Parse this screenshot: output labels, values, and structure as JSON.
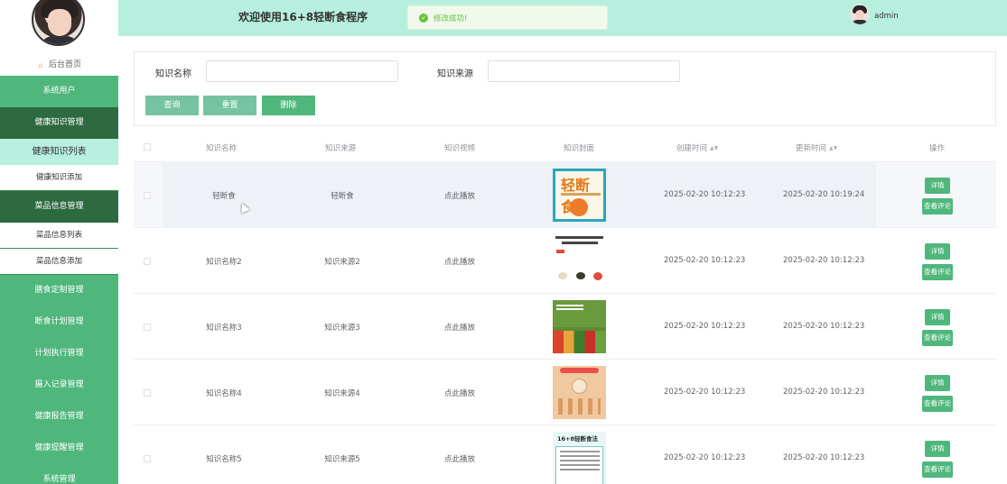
{
  "header": {
    "welcome": "欢迎使用16+8轻断食程序",
    "toast": "修改成功!",
    "username": "admin"
  },
  "sidebar": {
    "home": "后台首页",
    "items": [
      {
        "label": "系统用户",
        "style": "normal"
      },
      {
        "label": "健康知识管理",
        "style": "dark"
      },
      {
        "label": "健康知识列表",
        "style": "active-sub"
      },
      {
        "label": "健康知识添加",
        "style": "sub"
      },
      {
        "label": "菜品信息管理",
        "style": "dark"
      },
      {
        "label": "菜品信息列表",
        "style": "sub"
      },
      {
        "label": "菜品信息添加",
        "style": "sub"
      },
      {
        "label": "膳食定制管理",
        "style": "normal"
      },
      {
        "label": "断食计划管理",
        "style": "normal"
      },
      {
        "label": "计划执行管理",
        "style": "normal"
      },
      {
        "label": "摄入记录管理",
        "style": "normal"
      },
      {
        "label": "健康报告管理",
        "style": "normal"
      },
      {
        "label": "健康提醒管理",
        "style": "normal"
      },
      {
        "label": "系统管理",
        "style": "normal"
      }
    ]
  },
  "search": {
    "name_label": "知识名称",
    "name_value": "",
    "source_label": "知识来源",
    "source_value": "",
    "query": "查询",
    "reset": "重置",
    "delete": "删除"
  },
  "table": {
    "headers": {
      "name": "知识名称",
      "source": "知识来源",
      "video": "知识视频",
      "cover": "知识封面",
      "created": "创建时间",
      "updated": "更新时间",
      "ops": "操作"
    },
    "detail_label": "详情",
    "comment_label": "查看评论",
    "rows": [
      {
        "name": "轻断食",
        "source": "轻断食",
        "video": "点此播放",
        "cover_title": "轻断食",
        "created": "2025-02-20 10:12:23",
        "updated": "2025-02-20 10:19:24"
      },
      {
        "name": "知识名称2",
        "source": "知识来源2",
        "video": "点此播放",
        "created": "2025-02-20 10:12:23",
        "updated": "2025-02-20 10:12:23"
      },
      {
        "name": "知识名称3",
        "source": "知识来源3",
        "video": "点此播放",
        "created": "2025-02-20 10:12:23",
        "updated": "2025-02-20 10:12:23"
      },
      {
        "name": "知识名称4",
        "source": "知识来源4",
        "video": "点此播放",
        "created": "2025-02-20 10:12:23",
        "updated": "2025-02-20 10:12:23"
      },
      {
        "name": "知识名称5",
        "source": "知识来源5",
        "video": "点此播放",
        "cover_title": "16+8轻断食法",
        "created": "2025-02-20 10:12:23",
        "updated": "2025-02-20 10:12:23"
      }
    ]
  }
}
